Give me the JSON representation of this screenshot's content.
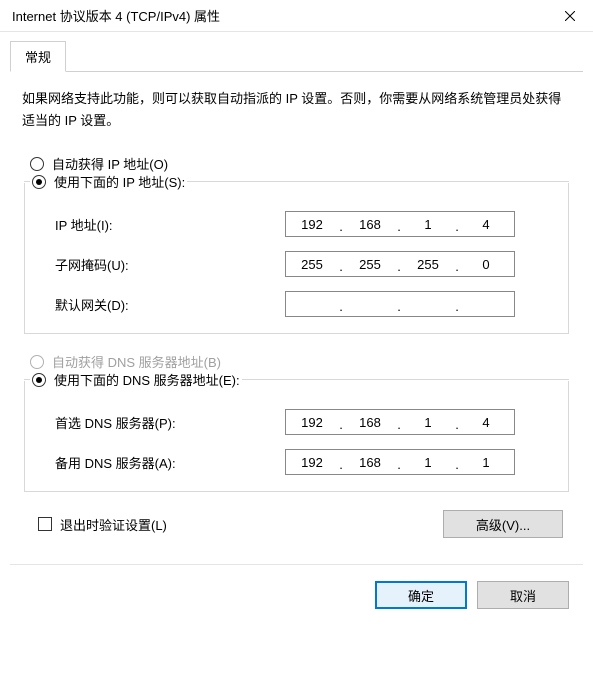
{
  "window": {
    "title": "Internet 协议版本 4 (TCP/IPv4) 属性"
  },
  "tabs": {
    "general": "常规"
  },
  "description": "如果网络支持此功能，则可以获取自动指派的 IP 设置。否则，你需要从网络系统管理员处获得适当的 IP 设置。",
  "ip_section": {
    "auto_label": "自动获得 IP 地址(O)",
    "manual_label": "使用下面的 IP 地址(S):",
    "selected": "manual",
    "fields": {
      "ip_label": "IP 地址(I):",
      "ip_value": {
        "o1": "192",
        "o2": "168",
        "o3": "1",
        "o4": "4"
      },
      "mask_label": "子网掩码(U):",
      "mask_value": {
        "o1": "255",
        "o2": "255",
        "o3": "255",
        "o4": "0"
      },
      "gateway_label": "默认网关(D):",
      "gateway_value": {
        "o1": "",
        "o2": "",
        "o3": "",
        "o4": ""
      }
    }
  },
  "dns_section": {
    "auto_label": "自动获得 DNS 服务器地址(B)",
    "manual_label": "使用下面的 DNS 服务器地址(E):",
    "selected": "manual",
    "auto_disabled": true,
    "fields": {
      "preferred_label": "首选 DNS 服务器(P):",
      "preferred_value": {
        "o1": "192",
        "o2": "168",
        "o3": "1",
        "o4": "4"
      },
      "alternate_label": "备用 DNS 服务器(A):",
      "alternate_value": {
        "o1": "192",
        "o2": "168",
        "o3": "1",
        "o4": "1"
      }
    }
  },
  "validate_checkbox": {
    "label": "退出时验证设置(L)",
    "checked": false
  },
  "buttons": {
    "advanced": "高级(V)...",
    "ok": "确定",
    "cancel": "取消"
  }
}
